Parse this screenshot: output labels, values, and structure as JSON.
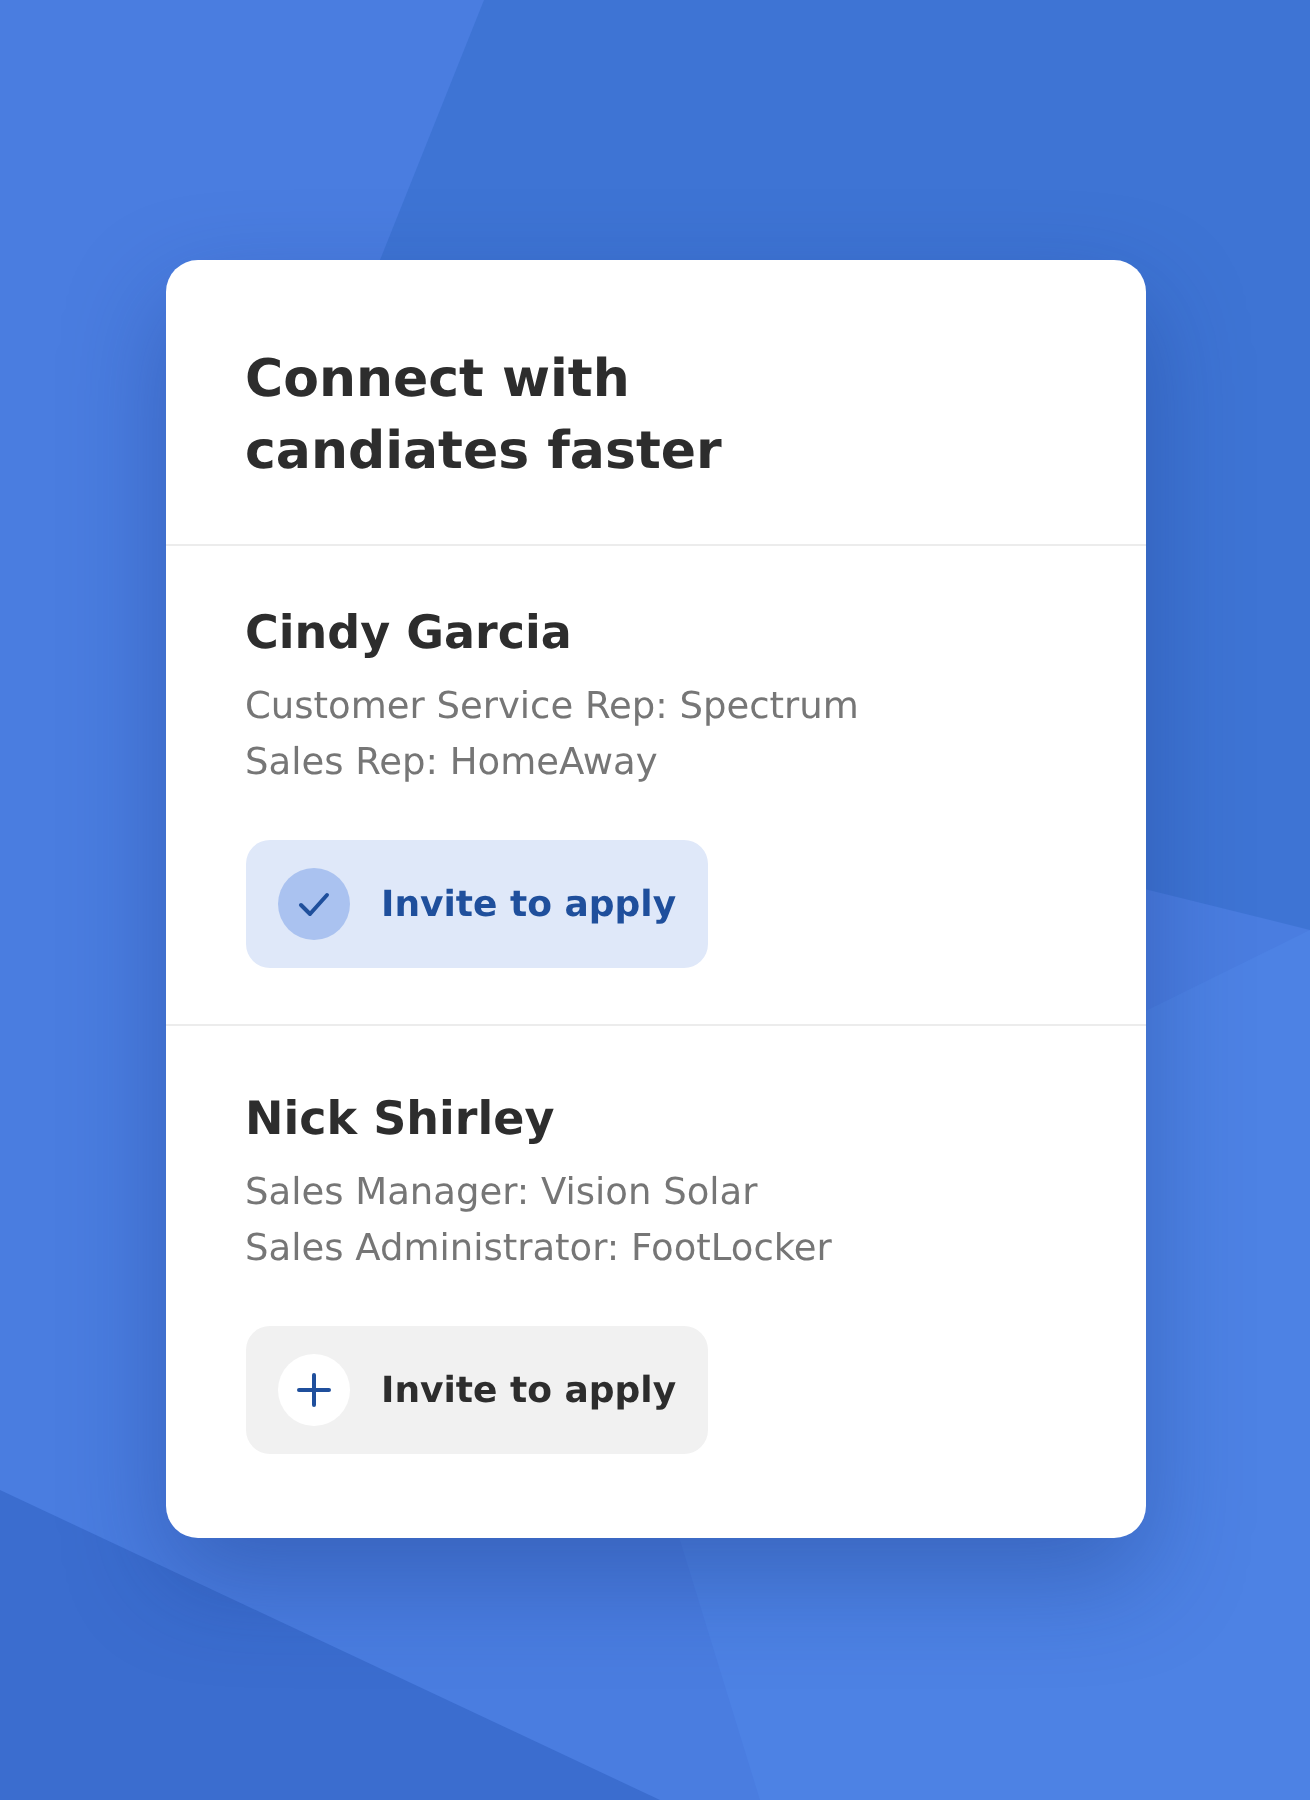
{
  "card": {
    "title": "Connect with candiates faster"
  },
  "candidates": [
    {
      "name": "Cindy Garcia",
      "roles": [
        "Customer Service Rep: Spectrum",
        "Sales Rep: HomeAway"
      ],
      "invite": {
        "label": "Invite to apply",
        "invited": true
      }
    },
    {
      "name": "Nick Shirley",
      "roles": [
        "Sales Manager: Vision Solar",
        "Sales Administrator: FootLocker"
      ],
      "invite": {
        "label": "Invite to apply",
        "invited": false
      }
    }
  ]
}
